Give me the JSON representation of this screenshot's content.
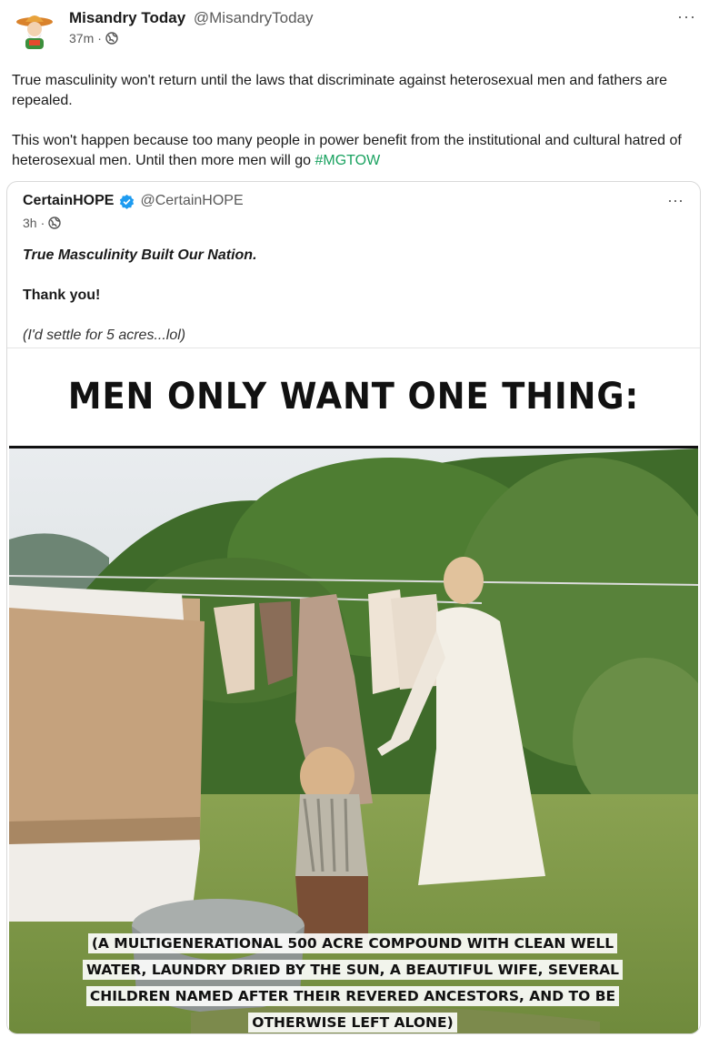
{
  "post": {
    "author_name": "Misandry Today",
    "author_handle": "@MisandryToday",
    "time": "37m",
    "visibility_icon": "globe-icon",
    "more_label": "···",
    "paragraph1": "True masculinity won't return until the laws that discriminate against heterosexual men and fathers are repealed.",
    "paragraph2_text": "This won't happen because too many people in power benefit from the institutional and cultural hatred of heterosexual men. Until then more men will go ",
    "hashtag": "#MGTOW"
  },
  "quoted": {
    "author_name": "CertainHOPE",
    "author_handle": "@CertainHOPE",
    "time": "3h",
    "more_label": "···",
    "line1": "True Masculinity Built Our Nation.",
    "line2": "Thank you!",
    "line3": "(I'd settle for 5 acres...lol)",
    "meme_title": "MEN ONLY WANT ONE THING:",
    "meme_caption": "(A MULTIGENERATIONAL 500 ACRE COMPOUND WITH CLEAN WELL WATER, LAUNDRY DRIED BY THE SUN, A BEAUTIFUL WIFE, SEVERAL CHILDREN NAMED AFTER THEIR REVERED ANCESTORS, AND TO BE OTHERWISE LEFT ALONE)"
  },
  "colors": {
    "hashtag": "#1aa260",
    "verified": "#1d9bf0"
  }
}
